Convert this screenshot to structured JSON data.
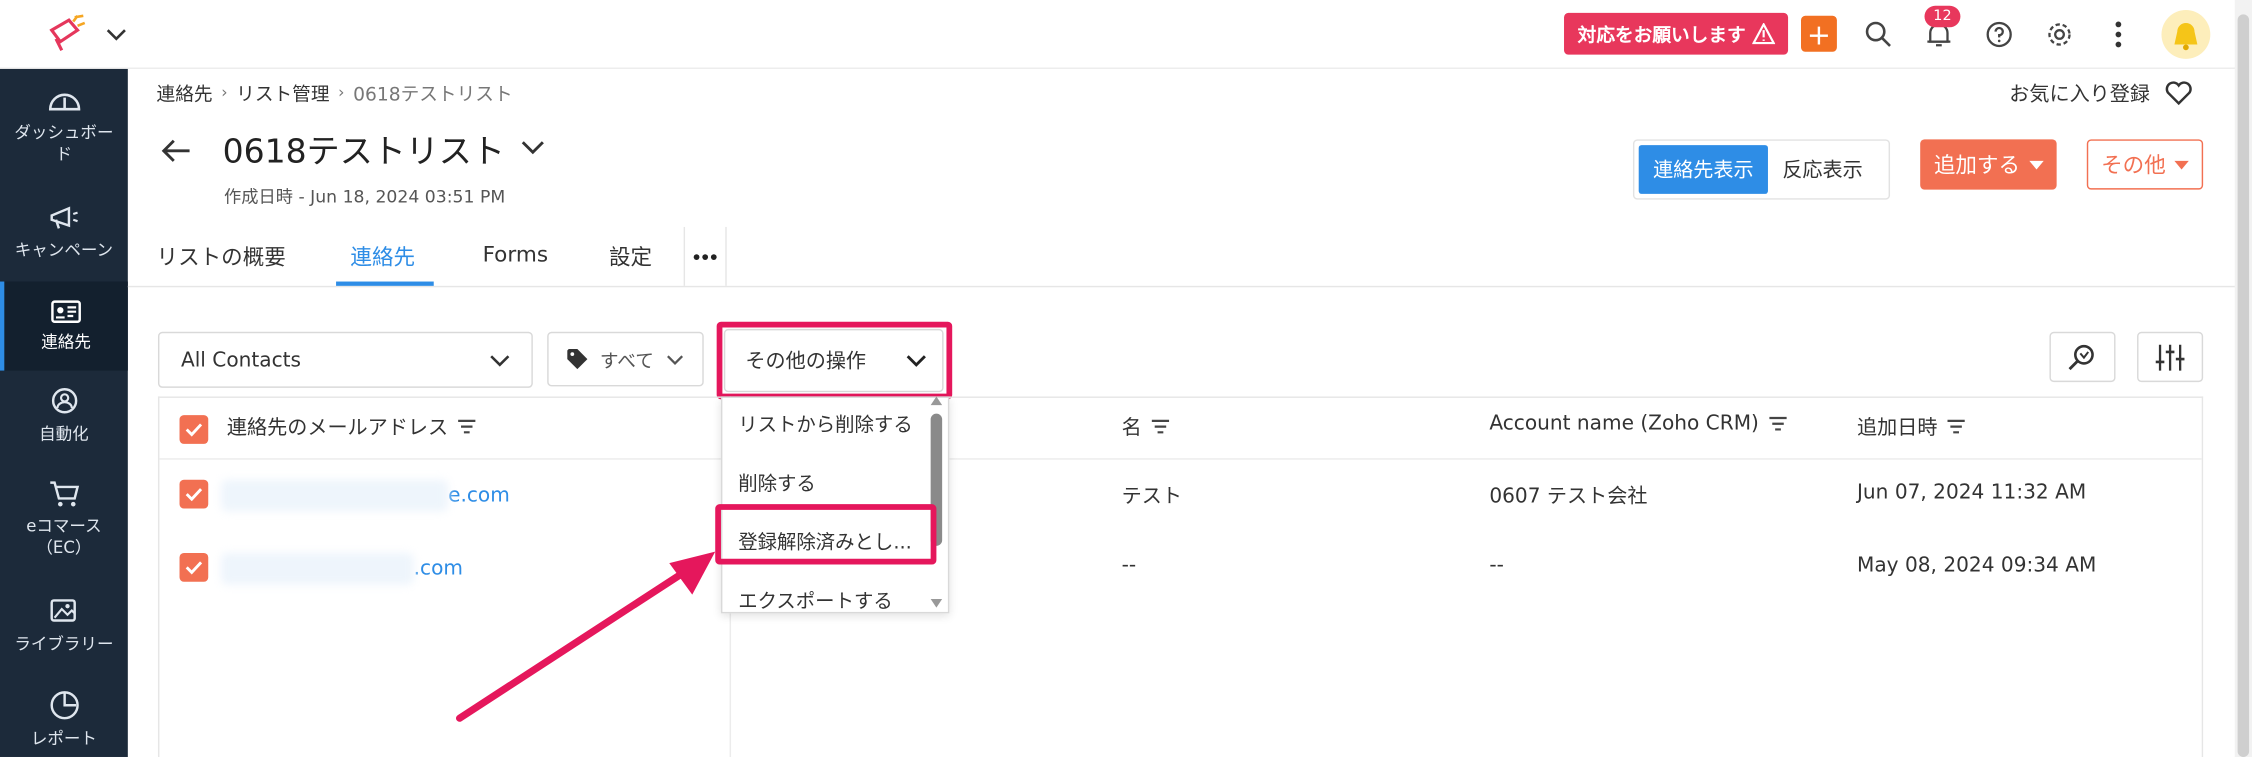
{
  "topbar": {
    "urgent_label": "対応をお願いします",
    "plus_label": "+",
    "notification_count": "12",
    "icons": [
      "campaign-logo-icon",
      "search-icon",
      "bell-icon",
      "help-icon",
      "gear-icon",
      "kebab-icon"
    ]
  },
  "sidebar": {
    "items": [
      {
        "label": "ダッシュボード",
        "icon": "dashboard-icon"
      },
      {
        "label": "キャンペーン",
        "icon": "megaphone-icon"
      },
      {
        "label": "連絡先",
        "icon": "contact-card-icon",
        "active": true
      },
      {
        "label": "自動化",
        "icon": "automation-icon"
      },
      {
        "label": "eコマース（EC）",
        "icon": "cart-icon"
      },
      {
        "label": "ライブラリー",
        "icon": "library-icon"
      },
      {
        "label": "レポート",
        "icon": "report-icon"
      }
    ]
  },
  "breadcrumb": {
    "items": [
      "連絡先",
      "リスト管理",
      "0618テストリスト"
    ]
  },
  "favorite_label": "お気に入り登録",
  "page": {
    "title": "0618テストリスト",
    "created": "作成日時 - Jun 18, 2024 03:51 PM"
  },
  "view_toggle": {
    "contacts_view": "連絡先表示",
    "reaction_view": "反応表示"
  },
  "actions": {
    "add": "追加する",
    "other": "その他"
  },
  "tabs": [
    {
      "label": "リストの概要"
    },
    {
      "label": "連絡先",
      "active": true
    },
    {
      "label": "Forms"
    },
    {
      "label": "設定"
    }
  ],
  "filters": {
    "contacts_dropdown": "All Contacts",
    "tags_dropdown": "すべて",
    "ops_dropdown": "その他の操作"
  },
  "ops_menu": {
    "items": [
      "リストから削除する",
      "削除する",
      "登録解除済みとし...",
      "エクスポートする"
    ],
    "highlighted_index": 2
  },
  "table": {
    "headers": [
      "連絡先のメールアドレス",
      "名",
      "Account name (Zoho CRM)",
      "追加日時"
    ],
    "rows": [
      {
        "email_suffix": "e.com",
        "name": "テスト",
        "account": "0607 テスト会社",
        "added": "Jun 07, 2024 11:32 AM",
        "checked": true
      },
      {
        "email_suffix": ".com",
        "name": "--",
        "account": "--",
        "added": "May 08, 2024 09:34 AM",
        "checked": true
      }
    ]
  },
  "colors": {
    "sidebar_bg": "#1c2a3a",
    "accent_blue": "#2e8de6",
    "accent_orange": "#f27052",
    "highlight": "#e5175c"
  }
}
